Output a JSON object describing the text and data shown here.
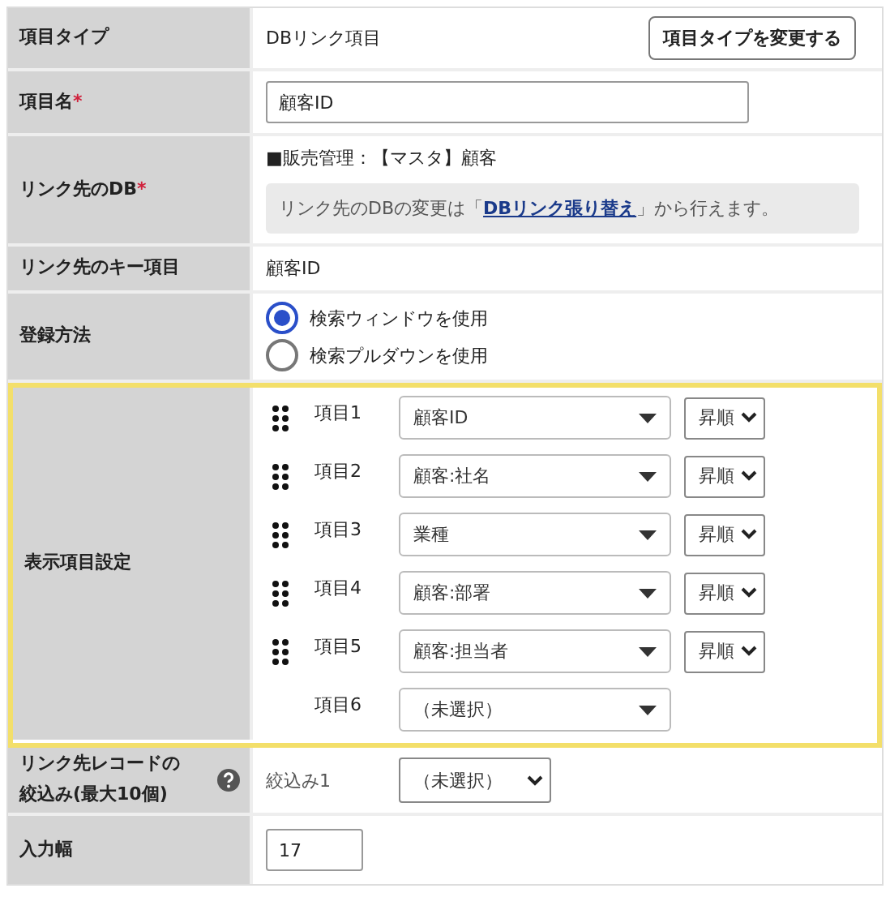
{
  "rows": [
    {
      "kind": "type",
      "label": "項目タイプ",
      "value": "DBリンク項目",
      "button": "項目タイプを変更する"
    },
    {
      "kind": "input",
      "label": "項目名",
      "required_mark": "*",
      "value": "顧客ID"
    },
    {
      "kind": "db",
      "label": "リンク先のDB",
      "required_mark": "*",
      "value": "■販売管理：【マスタ】顧客",
      "note_before": "リンク先のDBの変更は「",
      "link": "DBリンク張り替え",
      "note_after": "」から行えます。"
    },
    {
      "kind": "text",
      "label": "リンク先のキー項目",
      "value": "顧客ID"
    },
    {
      "kind": "radio",
      "label": "登録方法",
      "options": [
        {
          "label": "検索ウィンドウを使用",
          "selected": true
        },
        {
          "label": "検索プルダウンを使用",
          "selected": false
        }
      ]
    },
    {
      "kind": "display_items",
      "label": "表示項目設定",
      "highlighted": true,
      "items": [
        {
          "label": "項目1",
          "value": "顧客ID",
          "draggable": true,
          "order": "昇順"
        },
        {
          "label": "項目2",
          "value": "顧客:社名",
          "draggable": true,
          "order": "昇順"
        },
        {
          "label": "項目3",
          "value": "業種",
          "draggable": true,
          "order": "昇順"
        },
        {
          "label": "項目4",
          "value": "顧客:部署",
          "draggable": true,
          "order": "昇順"
        },
        {
          "label": "項目5",
          "value": "顧客:担当者",
          "draggable": true,
          "order": "昇順"
        },
        {
          "label": "項目6",
          "value": "（未選択）",
          "draggable": false
        }
      ]
    },
    {
      "kind": "filter",
      "label": "リンク先レコードの絞込み(最大10個)",
      "help": true,
      "filters": [
        {
          "label": "絞込み1",
          "value": "（未選択）"
        }
      ]
    },
    {
      "kind": "input_small",
      "label": "入力幅",
      "value": "17"
    }
  ]
}
